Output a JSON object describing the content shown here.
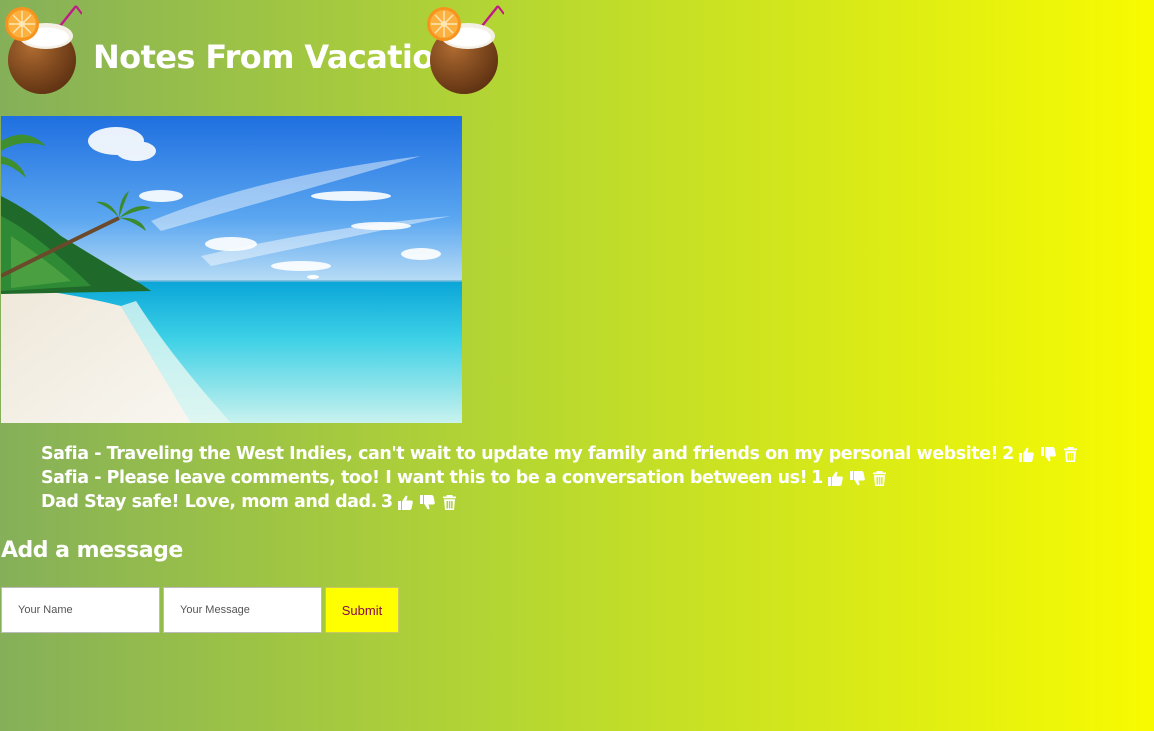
{
  "header": {
    "title": "Notes From Vacation",
    "decoration_icon": "coconut-drink-icon"
  },
  "hero": {
    "image": "tropical-beach-photo"
  },
  "messages": [
    {
      "text": "Safia - Traveling the West Indies, can't wait to update my family and friends on my personal website!",
      "likes": "2"
    },
    {
      "text": "Safia - Please leave comments, too! I want this to be a conversation between us!",
      "likes": "1"
    },
    {
      "text": "Dad Stay safe! Love, mom and dad.",
      "likes": "3"
    }
  ],
  "message_actions": {
    "like_icon": "thumbs-up-icon",
    "dislike_icon": "thumbs-down-icon",
    "delete_icon": "trash-icon"
  },
  "form": {
    "heading": "Add a message",
    "name_placeholder": "Your Name",
    "name_value": "",
    "message_placeholder": "Your Message",
    "message_value": "",
    "submit_label": "Submit"
  },
  "colors": {
    "gradient_start": "#85b059",
    "gradient_end": "#f8fb00",
    "text": "#ffffff",
    "submit_background": "#ffff00",
    "submit_text": "#8b0a4a"
  }
}
